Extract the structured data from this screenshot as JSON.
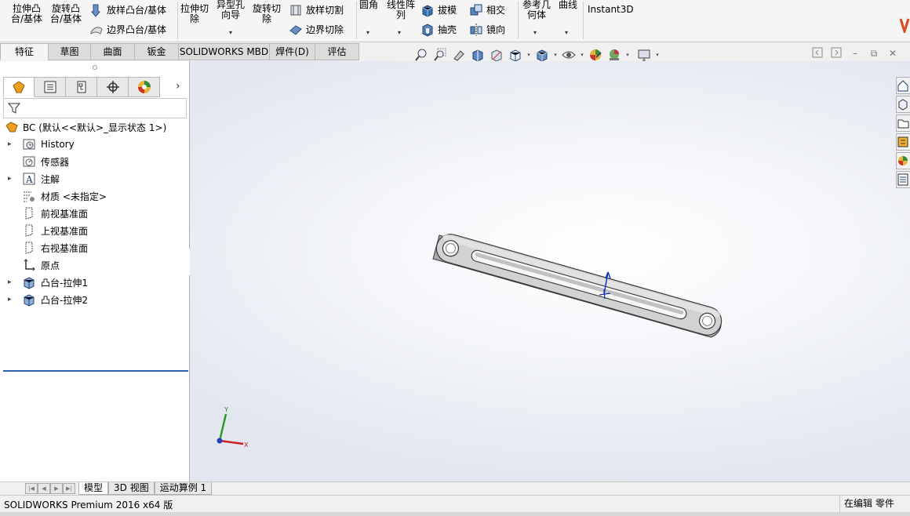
{
  "ribbon": {
    "extrude_boss_line1": "拉伸凸",
    "extrude_boss_line2": "台/基体",
    "revolve_boss_line1": "旋转凸",
    "revolve_boss_line2": "台/基体",
    "swept_boss": "放样凸台/基体",
    "boundary_boss": "边界凸台/基体",
    "extrude_cut_line1": "拉伸切",
    "extrude_cut_line2": "除",
    "hole_wizard_line1": "异型孔",
    "hole_wizard_line2": "向导",
    "revolve_cut_line1": "旋转切",
    "revolve_cut_line2": "除",
    "loft_cut": "放样切割",
    "boundary_cut": "边界切除",
    "fillet": "圆角",
    "linear_pattern_line1": "线性阵",
    "linear_pattern_line2": "列",
    "draft": "拔模",
    "intersect": "相交",
    "shell": "抽壳",
    "mirror": "镜向",
    "ref_geom_line1": "参考几",
    "ref_geom_line2": "何体",
    "curves": "曲线",
    "instant3d": "Instant3D",
    "dropdown_glyph": "▾"
  },
  "tabs": [
    {
      "label": "特征"
    },
    {
      "label": "草图"
    },
    {
      "label": "曲面"
    },
    {
      "label": "钣金"
    },
    {
      "label": "SOLIDWORKS MBD"
    },
    {
      "label": "焊件(D)"
    },
    {
      "label": "评估"
    }
  ],
  "panel": {
    "more_glyph": "›",
    "tree": {
      "root": "BC  (默认<<默认>_显示状态 1>)",
      "items": [
        {
          "label": "History",
          "expand": "▸"
        },
        {
          "label": "传感器",
          "expand": ""
        },
        {
          "label": "注解",
          "expand": "▸"
        },
        {
          "label": "材质 <未指定>",
          "expand": ""
        },
        {
          "label": "前视基准面",
          "expand": ""
        },
        {
          "label": "上视基准面",
          "expand": ""
        },
        {
          "label": "右视基准面",
          "expand": ""
        },
        {
          "label": "原点",
          "expand": ""
        },
        {
          "label": "凸台-拉伸1",
          "expand": "▸"
        },
        {
          "label": "凸台-拉伸2",
          "expand": "▸"
        }
      ]
    }
  },
  "window_controls": {
    "restore": "⧉",
    "minimize": "–",
    "maximize": "□",
    "close": "✕"
  },
  "triad": {
    "y": "Y",
    "x": "X"
  },
  "bottom_tabs": [
    {
      "label": "模型"
    },
    {
      "label": "3D 视图"
    },
    {
      "label": "运动算例 1"
    }
  ],
  "status": {
    "left": "SOLIDWORKS Premium 2016 x64 版",
    "right": "在编辑 零件"
  },
  "colors": {
    "accent": "#2f5fb0",
    "part_face": "#d2d2d2",
    "part_edge": "#3a3a3a"
  }
}
